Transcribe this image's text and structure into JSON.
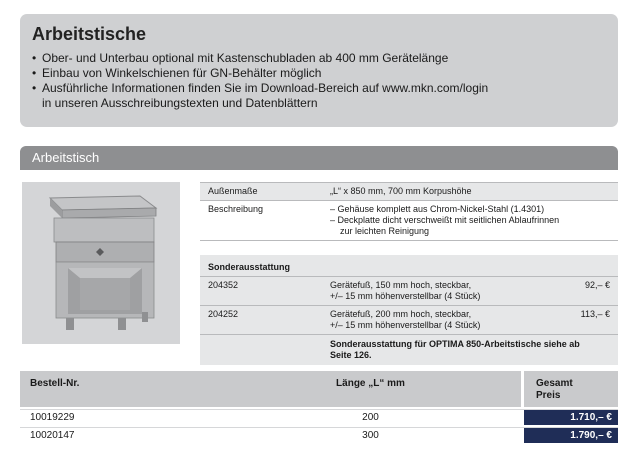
{
  "info": {
    "title": "Arbeitstische",
    "bullets": [
      "Ober- und Unterbau optional mit Kastenschubladen ab 400 mm Gerätelänge",
      "Einbau von Winkelschienen für GN-Behälter möglich",
      "Ausführliche Informationen finden Sie im Download-Bereich auf www.mkn.com/login"
    ],
    "continuation": "in unseren Ausschreibungstexten und Datenblättern"
  },
  "section": {
    "title": "Arbeitstisch"
  },
  "image": {
    "description_icon": "worktable-image"
  },
  "spec": {
    "rows": [
      {
        "key": "Außenmaße",
        "value": "„L“ x 850 mm, 700 mm Korpushöhe"
      },
      {
        "key": "Beschreibung",
        "value_lines": [
          "– Gehäuse komplett aus Chrom-Nickel-Stahl (1.4301)",
          "– Deckplatte dicht verschweißt mit seitlichen Ablaufrinnen",
          "   zur leichten Reinigung"
        ]
      }
    ],
    "options_title": "Sonderausstattung",
    "options": [
      {
        "code": "204352",
        "desc_lines": [
          "Gerätefuß, 150 mm hoch, steckbar,",
          "+/– 15 mm höhenverstellbar (4 Stück)"
        ],
        "price": "92,– €"
      },
      {
        "code": "204252",
        "desc_lines": [
          "Gerätefuß, 200 mm hoch, steckbar,",
          "+/– 15 mm höhenverstellbar (4 Stück)"
        ],
        "price": "113,– €"
      }
    ],
    "note_lines": [
      "Sonderausstattung für OPTIMA 850-Arbeitstische siehe ab",
      "Seite 126."
    ]
  },
  "order": {
    "headers": {
      "number": "Bestell-Nr.",
      "length": "Länge „L“ mm",
      "price_line1": "Gesamt",
      "price_line2": "Preis"
    },
    "rows": [
      {
        "number": "10019229",
        "length": "200",
        "price": "1.710,– €"
      },
      {
        "number": "10020147",
        "length": "300",
        "price": "1.790,– €"
      }
    ]
  }
}
